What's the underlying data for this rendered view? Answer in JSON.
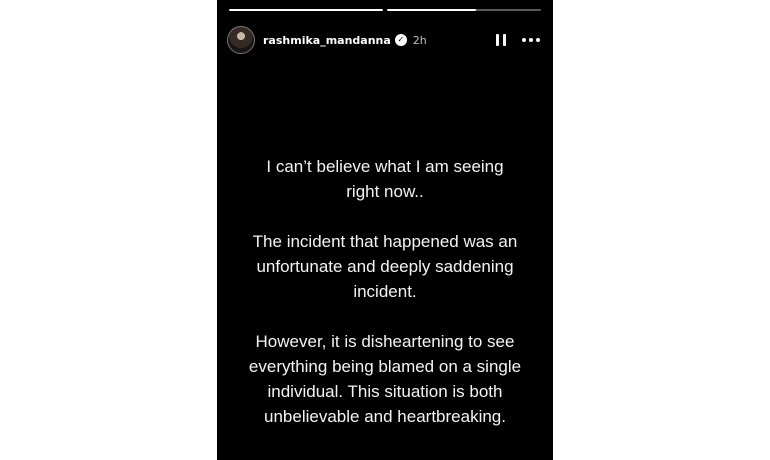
{
  "story": {
    "progress": [
      1.0,
      0.58
    ],
    "user": {
      "username": "rashmika_mandanna",
      "verified_icon": "verified-badge-icon",
      "timestamp": "2h"
    },
    "controls": {
      "pause_icon": "pause-icon",
      "more_icon": "more-options-icon"
    },
    "paragraphs": [
      "I can’t believe what I am seeing\nright now..",
      "The incident that happened was an\nunfortunate and deeply saddening\nincident.",
      "However, it is disheartening to see\neverything being blamed on a single\nindividual. This situation is both\nunbelievable and heartbreaking."
    ],
    "colors": {
      "background": "#000000",
      "text": "#ffffff"
    }
  }
}
